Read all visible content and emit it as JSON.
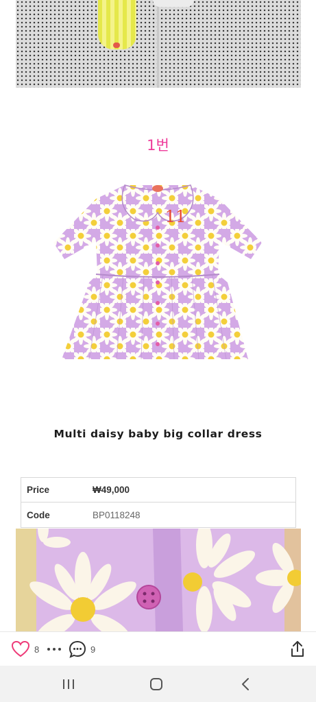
{
  "item_label": "1번",
  "product": {
    "title": "Multi daisy baby big collar dress",
    "dress_tag_number": "11"
  },
  "info": [
    {
      "key": "Price",
      "value": "₩49,000"
    },
    {
      "key": "Code",
      "value": "BP0118248"
    }
  ],
  "actions": {
    "like_count": "8",
    "comment_count": "9",
    "icons": [
      "heart-icon",
      "more-icon",
      "comment-icon",
      "share-icon"
    ]
  },
  "nav": {
    "icons": [
      "recent-apps-icon",
      "home-icon",
      "back-icon"
    ]
  },
  "colors": {
    "accent_pink": "#ee3a9a",
    "dress_lavender": "#d3a9e6"
  }
}
